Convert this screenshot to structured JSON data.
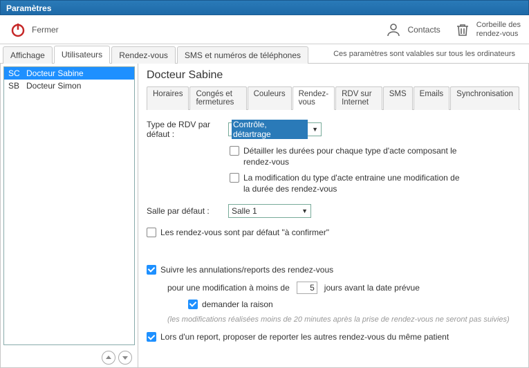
{
  "window": {
    "title": "Paramètres"
  },
  "toolbar": {
    "close": "Fermer",
    "contacts": "Contacts",
    "trash1": "Corbeille des",
    "trash2": "rendez-vous"
  },
  "tabs": {
    "items": [
      "Affichage",
      "Utilisateurs",
      "Rendez-vous",
      "SMS et numéros de téléphones"
    ],
    "note": "Ces paramètres sont valables sur tous les ordinateurs"
  },
  "users": [
    {
      "code": "SC",
      "name": "Docteur Sabine"
    },
    {
      "code": "SB",
      "name": "Docteur Simon"
    }
  ],
  "main": {
    "title": "Docteur Sabine",
    "subtabs": [
      "Horaires",
      "Congés et fermetures",
      "Couleurs",
      "Rendez-vous",
      "RDV sur Internet",
      "SMS",
      "Emails",
      "Synchronisation"
    ],
    "rdvtype_label": "Type de RDV par défaut :",
    "rdvtype_value": "Contrôle, détartrage",
    "opt_detail": "Détailler les durées pour chaque type d'acte composant le rendez-vous",
    "opt_modif": "La modification du type d'acte entraine une modification de la durée des rendez-vous",
    "room_label": "Salle par défaut :",
    "room_value": "Salle 1",
    "opt_confirm": "Les rendez-vous sont par défaut \"à confirmer\"",
    "opt_track": "Suivre les annulations/reports des rendez-vous",
    "track_sub1a": "pour une modification à moins de",
    "track_sub1_days": "5",
    "track_sub1b": "jours avant la date prévue",
    "opt_reason": "demander la raison",
    "hint": "(les modifications réalisées moins de 20 minutes après la prise de rendez-vous ne seront pas suivies)",
    "opt_report": "Lors d'un report, proposer de reporter les autres rendez-vous du même patient"
  }
}
